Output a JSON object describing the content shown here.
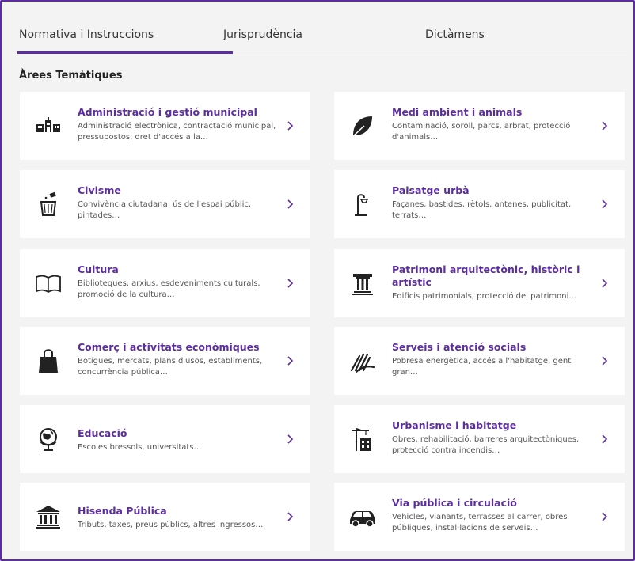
{
  "tabs": [
    {
      "label": "Normativa i Instruccions"
    },
    {
      "label": "Jurisprudència"
    },
    {
      "label": "Dictàmens"
    }
  ],
  "section_title": "Àrees Temàtiques",
  "cards": [
    {
      "title": "Administració i gestió municipal",
      "desc": "Administració electrònica, contractació municipal, pressupostos, dret d'accés a la…",
      "icon": "city-hall-icon"
    },
    {
      "title": "Medi ambient i animals",
      "desc": "Contaminació, soroll, parcs, arbrat, protecció d'animals…",
      "icon": "leaf-icon"
    },
    {
      "title": "Civisme",
      "desc": "Convivència ciutadana, ús de l'espai públic, pintades…",
      "icon": "trash-bin-icon"
    },
    {
      "title": "Paisatge urbà",
      "desc": "Façanes, bastides, rètols, antenes, publicitat, terrats…",
      "icon": "street-lamp-icon"
    },
    {
      "title": "Cultura",
      "desc": "Biblioteques, arxius, esdeveniments culturals, promoció de la cultura…",
      "icon": "open-book-icon"
    },
    {
      "title": "Patrimoni arquitectònic, històric i artístic",
      "desc": "Edificis patrimonials, protecció del patrimoni…",
      "icon": "column-icon"
    },
    {
      "title": "Comerç i activitats econòmiques",
      "desc": "Botigues, mercats, plans d'usos, establiments, concurrència pública…",
      "icon": "shopping-bag-icon"
    },
    {
      "title": "Serveis i atenció socials",
      "desc": "Pobresa energètica, accés a l'habitatge, gent gran…",
      "icon": "helping-hands-icon"
    },
    {
      "title": "Educació",
      "desc": "Escoles bressols, universitats…",
      "icon": "globe-icon"
    },
    {
      "title": "Urbanisme i habitatge",
      "desc": "Obres, rehabilitació, barreres arquitectòniques, protecció contra incendis…",
      "icon": "crane-building-icon"
    },
    {
      "title": "Hisenda Pública",
      "desc": "Tributs, taxes, preus públics, altres ingressos…",
      "icon": "bank-icon"
    },
    {
      "title": "Via pública i circulació",
      "desc": "Vehicles, vianants, terrasses al carrer, obres públiques, instal·lacions de serveis…",
      "icon": "car-icon"
    }
  ],
  "colors": {
    "accent": "#5b2d9e",
    "background": "#f3f3f3",
    "card": "#ffffff"
  }
}
